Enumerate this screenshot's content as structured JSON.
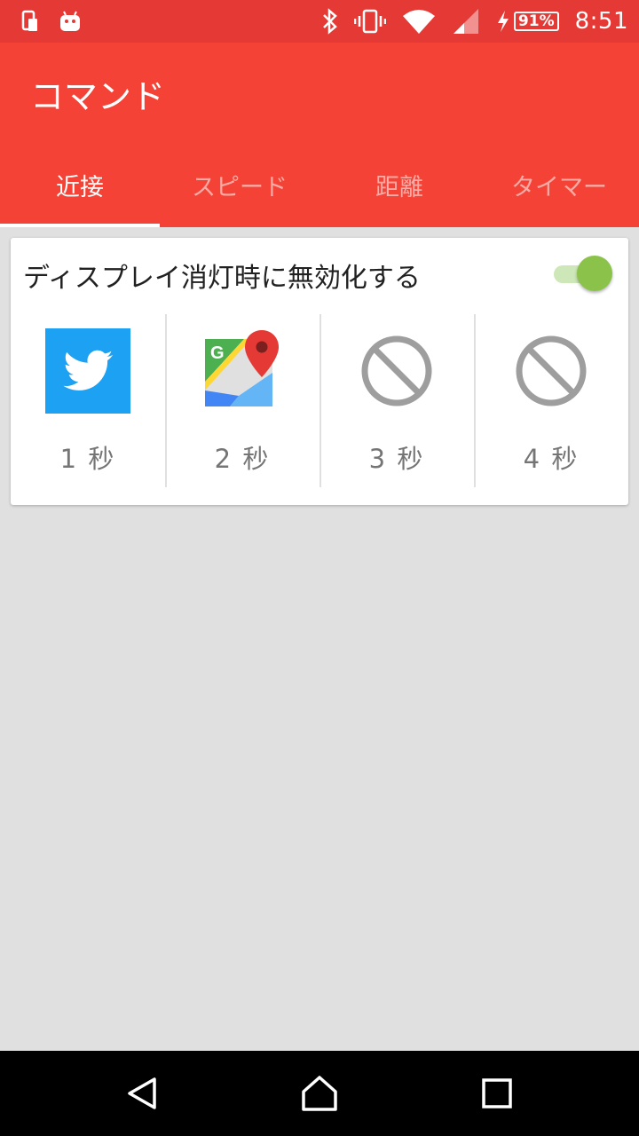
{
  "status_bar": {
    "left_icons": [
      "device-icon",
      "android-icon"
    ],
    "right_icons": [
      "bluetooth-icon",
      "vibrate-icon",
      "wifi-icon",
      "signal-icon",
      "charging-icon"
    ],
    "battery": "91%",
    "time": "8:51"
  },
  "app_bar": {
    "title": "コマンド",
    "color": "#f44336"
  },
  "tabs": [
    {
      "label": "近接",
      "active": true
    },
    {
      "label": "スピード",
      "active": false
    },
    {
      "label": "距離",
      "active": false
    },
    {
      "label": "タイマー",
      "active": false
    }
  ],
  "card": {
    "title": "ディスプレイ消灯時に無効化する",
    "toggle_on": true,
    "slots": [
      {
        "icon": "twitter-icon",
        "label": "1 秒"
      },
      {
        "icon": "google-maps-icon",
        "label": "2 秒"
      },
      {
        "icon": "no-action-icon",
        "label": "3 秒"
      },
      {
        "icon": "no-action-icon",
        "label": "4 秒"
      }
    ]
  },
  "nav_bar": {
    "buttons": [
      "back-icon",
      "home-icon",
      "recents-icon"
    ]
  }
}
